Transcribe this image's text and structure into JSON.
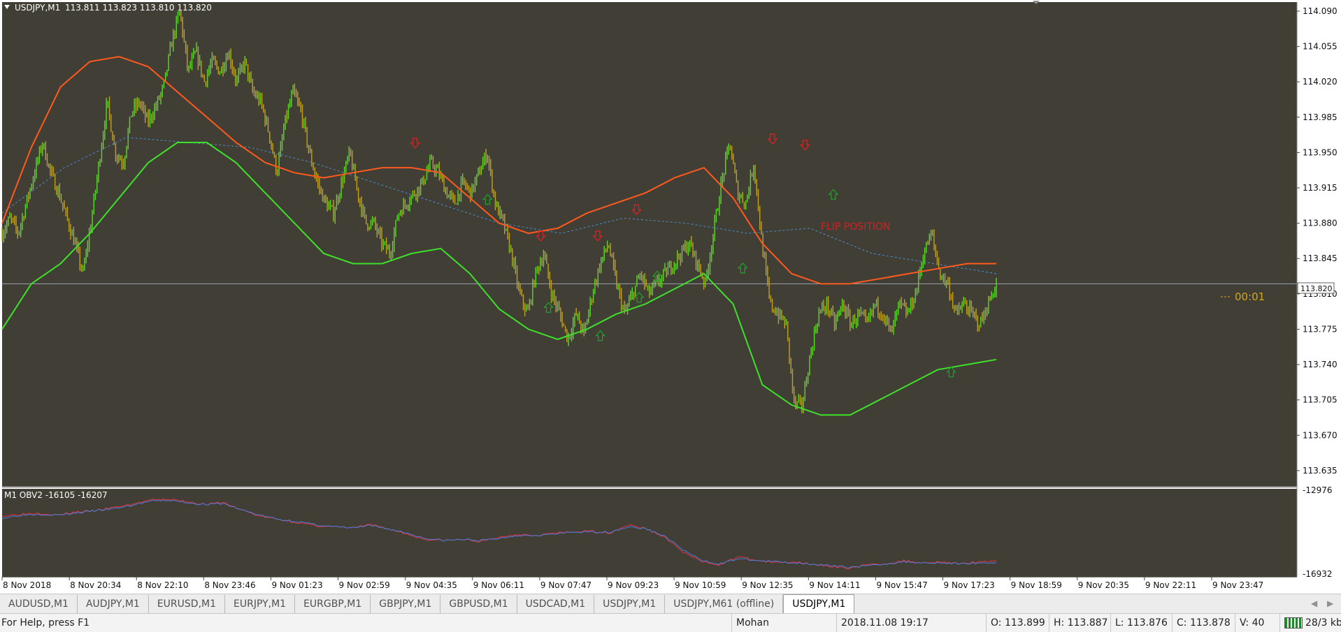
{
  "chart_header": {
    "symbol": "USDJPY,M1",
    "ohlc": "113.811 113.823 113.810 113.820"
  },
  "indicator_header": "M1 OBV2 -16105 -16207",
  "annotations": {
    "flip": "FLIP POSITION",
    "timer": "00:01",
    "bid_tag": "113.820"
  },
  "chart_data": [
    {
      "type": "line",
      "title": "USDJPY,M1",
      "price_ticks": [
        "114.090",
        "114.055",
        "114.020",
        "113.985",
        "113.950",
        "113.915",
        "113.880",
        "113.845",
        "113.810",
        "113.775",
        "113.740",
        "113.705",
        "113.670",
        "113.635"
      ],
      "time_ticks": [
        "8 Nov 2018",
        "8 Nov 20:34",
        "8 Nov 22:10",
        "8 Nov 23:46",
        "9 Nov 01:23",
        "9 Nov 02:59",
        "9 Nov 04:35",
        "9 Nov 06:11",
        "9 Nov 07:47",
        "9 Nov 09:23",
        "9 Nov 10:59",
        "9 Nov 12:35",
        "9 Nov 14:11",
        "9 Nov 15:47",
        "9 Nov 17:23",
        "9 Nov 18:59",
        "9 Nov 20:35",
        "9 Nov 22:11",
        "9 Nov 23:47"
      ],
      "ylim": [
        113.619,
        114.099
      ],
      "current_price": 113.82,
      "series": [
        {
          "values": [
            113.87,
            113.885,
            113.87,
            113.9,
            113.93,
            113.96,
            113.93,
            113.91,
            113.885,
            113.86,
            113.83,
            113.88,
            113.94,
            114.0,
            113.95,
            113.94,
            113.99,
            114.0,
            113.98,
            113.995,
            114.015,
            114.06,
            114.09,
            114.03,
            114.05,
            114.02,
            114.04,
            114.03,
            114.05,
            114.02,
            114.04,
            114.01,
            114.0,
            113.97,
            113.93,
            113.98,
            114.01,
            113.99,
            113.95,
            113.92,
            113.9,
            113.89,
            113.92,
            113.95,
            113.91,
            113.88,
            113.88,
            113.86,
            113.85,
            113.89,
            113.9,
            113.91,
            113.92,
            113.94,
            113.93,
            113.91,
            113.9,
            113.92,
            113.91,
            113.93,
            113.95,
            113.9,
            113.88,
            113.85,
            113.81,
            113.79,
            113.83,
            113.85,
            113.81,
            113.79,
            113.765,
            113.79,
            113.77,
            113.81,
            113.84,
            113.86,
            113.82,
            113.79,
            113.81,
            113.83,
            113.81,
            113.82,
            113.83,
            113.84,
            113.85,
            113.86,
            113.84,
            113.82,
            113.87,
            113.92,
            113.96,
            113.91,
            113.9,
            113.94,
            113.86,
            113.8,
            113.79,
            113.78,
            113.7,
            113.7,
            113.75,
            113.79,
            113.8,
            113.78,
            113.8,
            113.78,
            113.79,
            113.78,
            113.8,
            113.79,
            113.77,
            113.8,
            113.79,
            113.81,
            113.85,
            113.87,
            113.83,
            113.82,
            113.79,
            113.8,
            113.79,
            113.78,
            113.8,
            113.82
          ]
        },
        {
          "values": [
            113.89,
            113.935,
            113.965,
            113.96,
            113.955,
            113.94,
            113.92,
            113.9,
            113.88,
            113.87,
            113.885,
            113.88,
            113.87,
            113.875,
            113.85,
            113.84,
            113.83
          ]
        },
        {
          "values": [
            113.775,
            113.82,
            113.84,
            113.87,
            113.905,
            113.94,
            113.96,
            113.96,
            113.94,
            113.91,
            113.88,
            113.85,
            113.84,
            113.84,
            113.85,
            113.855,
            113.83,
            113.795,
            113.775,
            113.765,
            113.775,
            113.79,
            113.8,
            113.815,
            113.83,
            113.8,
            113.72,
            113.7,
            113.69,
            113.69,
            113.705,
            113.72,
            113.735,
            113.74,
            113.745
          ]
        },
        {
          "values": [
            113.88,
            113.955,
            114.015,
            114.04,
            114.045,
            114.035,
            114.01,
            113.985,
            113.96,
            113.94,
            113.93,
            113.925,
            113.93,
            113.935,
            113.935,
            113.93,
            113.905,
            113.88,
            113.87,
            113.875,
            113.89,
            113.9,
            113.91,
            113.925,
            113.935,
            113.905,
            113.86,
            113.83,
            113.82,
            113.82,
            113.825,
            113.83,
            113.835,
            113.84,
            113.84
          ]
        }
      ],
      "arrows_down": [
        [
          31.9,
          113.958
        ],
        [
          41.6,
          113.866
        ],
        [
          46.0,
          113.866
        ],
        [
          49.0,
          113.892
        ],
        [
          59.5,
          113.962
        ],
        [
          62.0,
          113.956
        ]
      ],
      "arrows_up": [
        [
          37.5,
          113.905
        ],
        [
          42.2,
          113.798
        ],
        [
          46.2,
          113.77
        ],
        [
          49.2,
          113.808
        ],
        [
          50.6,
          113.829
        ],
        [
          57.2,
          113.837
        ],
        [
          64.2,
          113.91
        ],
        [
          73.3,
          113.734
        ]
      ]
    },
    {
      "type": "line",
      "title": "M1 OBV2 -16105 -16207",
      "y_ticks": [
        "-12976",
        "-16932"
      ],
      "ylim": [
        -16932,
        -12976
      ],
      "series": [
        {
          "values": [
            -14200,
            -14100,
            -14050,
            -14150,
            -14000,
            -13950,
            -13800,
            -13650,
            -13450,
            -13400,
            -13500,
            -13650,
            -13550,
            -13900,
            -14200,
            -14350,
            -14500,
            -14650,
            -14700,
            -14750,
            -14600,
            -14800,
            -15050,
            -15300,
            -15350,
            -15300,
            -15400,
            -15200,
            -15050,
            -15100,
            -15000,
            -14950,
            -14900,
            -15000,
            -14600,
            -14800,
            -15200,
            -15900,
            -16350,
            -16500,
            -16100,
            -16300,
            -16400,
            -16350,
            -16450,
            -16600,
            -16650,
            -16500,
            -16450,
            -16300,
            -16400,
            -16350,
            -16450,
            -16350,
            -16300
          ]
        },
        {
          "values": [
            -14300,
            -14150,
            -14100,
            -14150,
            -14050,
            -13950,
            -13850,
            -13700,
            -13500,
            -13450,
            -13550,
            -13650,
            -13600,
            -13900,
            -14150,
            -14350,
            -14450,
            -14600,
            -14700,
            -14750,
            -14650,
            -14800,
            -15000,
            -15250,
            -15350,
            -15300,
            -15350,
            -15250,
            -15100,
            -15100,
            -15050,
            -14950,
            -14950,
            -14950,
            -14700,
            -14800,
            -15150,
            -15800,
            -16300,
            -16450,
            -16200,
            -16300,
            -16350,
            -16400,
            -16450,
            -16550,
            -16600,
            -16550,
            -16450,
            -16350,
            -16400,
            -16400,
            -16450,
            -16400,
            -16400
          ]
        }
      ]
    }
  ],
  "tabs": [
    "AUDUSD,M1",
    "AUDJPY,M1",
    "EURUSD,M1",
    "EURJPY,M1",
    "EURGBP,M1",
    "GBPJPY,M1",
    "GBPUSD,M1",
    "USDCAD,M1",
    "USDJPY,M1",
    "USDJPY,M61 (offline)",
    "USDJPY,M1"
  ],
  "status": {
    "help": "For Help, press F1",
    "profile": "Mohan",
    "datetime": "2018.11.08 19:17",
    "open": "O: 113.899",
    "high": "H: 113.887",
    "low": "L: 113.876",
    "close": "C: 113.878",
    "volume": "V: 40",
    "traffic": "28/3 kb"
  },
  "colors": {
    "background": "#403e35",
    "bull": "#5ed829",
    "bear": "#c2a222",
    "upper_band": "#ff5a1e",
    "lower_band": "#3ee02a",
    "middle_line": "#4a8fd0",
    "arrow_down": "#e02020",
    "arrow_up": "#1f9e2a",
    "obv_main": "#e0323c",
    "obv_signal": "#4a7fe0",
    "timer": "#d4a818"
  }
}
